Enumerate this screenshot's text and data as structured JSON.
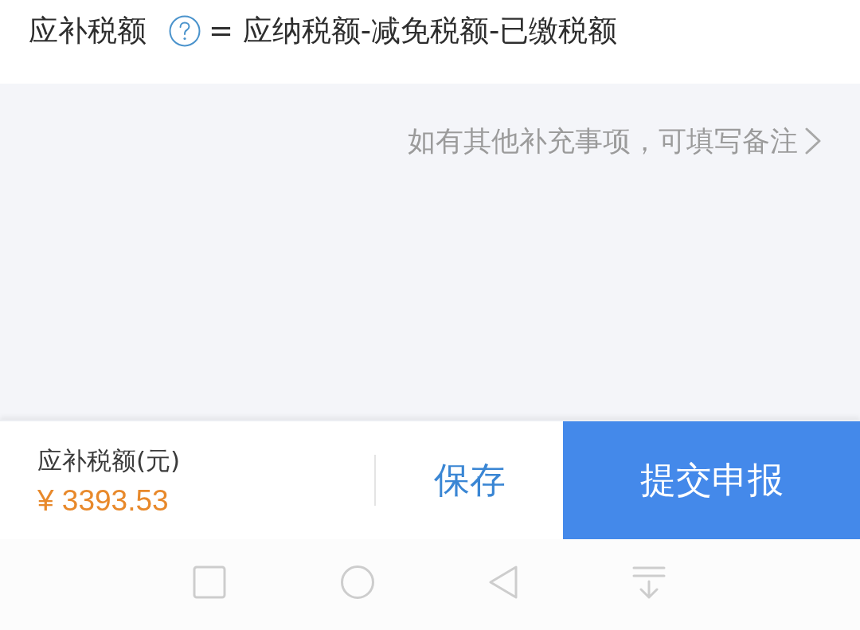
{
  "formula": {
    "label": "应补税额",
    "expression": "= 应纳税额-减免税额-已缴税额"
  },
  "remark_link": {
    "label": "如有其他补充事项，可填写备注"
  },
  "footer": {
    "amount_label": "应补税额(元)",
    "amount": "¥ 3393.53",
    "save_button": "保存",
    "submit_button": "提交申报"
  },
  "nav_bar": {
    "buttons": [
      {
        "kind": "recents"
      },
      {
        "kind": "home"
      },
      {
        "kind": "back"
      },
      {
        "kind": "notifications"
      }
    ]
  }
}
